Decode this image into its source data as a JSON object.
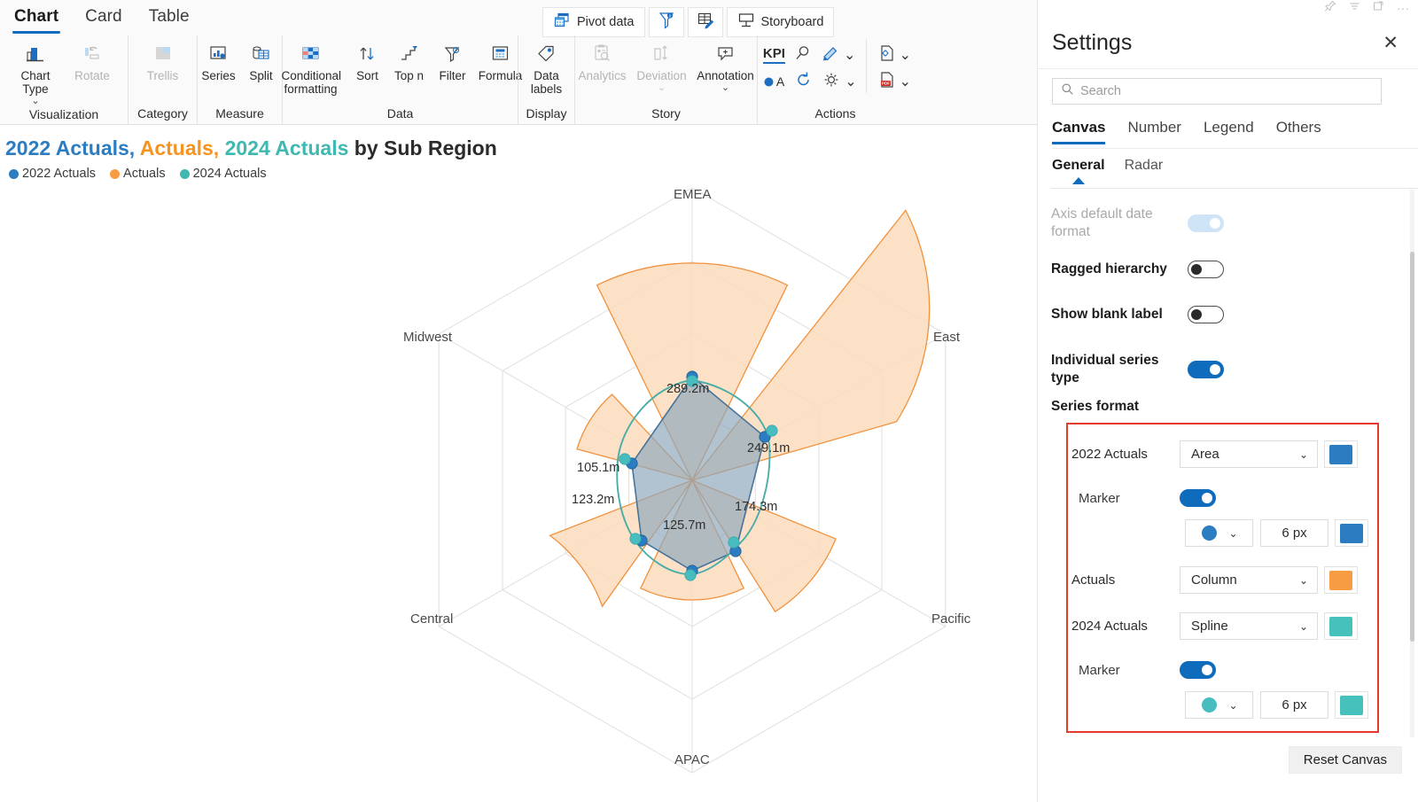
{
  "ribbon": {
    "tabs": [
      {
        "label": "Chart",
        "active": true
      },
      {
        "label": "Card",
        "active": false
      },
      {
        "label": "Table",
        "active": false
      }
    ],
    "groups": [
      {
        "title": "Visualization",
        "items": [
          {
            "label": "Chart Type",
            "icon": "bar-chart-icon",
            "disabled": false,
            "caret": true
          },
          {
            "label": "Rotate",
            "icon": "rotate-icon",
            "disabled": true,
            "caret": false
          }
        ]
      },
      {
        "title": "Category",
        "items": [
          {
            "label": "Trellis",
            "icon": "trellis-grid-icon",
            "disabled": true,
            "caret": false
          }
        ]
      },
      {
        "title": "Measure",
        "items": [
          {
            "label": "Series",
            "icon": "series-icon",
            "disabled": false,
            "caret": false
          },
          {
            "label": "Split",
            "icon": "split-icon",
            "disabled": false,
            "caret": false
          }
        ]
      },
      {
        "title": "Data",
        "items": [
          {
            "label": "Conditional formatting",
            "icon": "conditional-formatting-icon",
            "disabled": false,
            "caret": true
          },
          {
            "label": "Sort",
            "icon": "sort-icon",
            "disabled": false,
            "caret": false
          },
          {
            "label": "Top n",
            "icon": "top-n-icon",
            "disabled": false,
            "caret": false
          },
          {
            "label": "Filter",
            "icon": "filter-icon",
            "disabled": false,
            "caret": false
          },
          {
            "label": "Formula",
            "icon": "formula-icon",
            "disabled": false,
            "caret": false
          }
        ]
      },
      {
        "title": "Display",
        "items": [
          {
            "label": "Data labels",
            "icon": "tag-icon",
            "disabled": false,
            "caret": false
          }
        ]
      },
      {
        "title": "Story",
        "items": [
          {
            "label": "Analytics",
            "icon": "analytics-icon",
            "disabled": true,
            "caret": false
          },
          {
            "label": "Deviation",
            "icon": "deviation-icon",
            "disabled": true,
            "caret": true
          },
          {
            "label": "Annotation",
            "icon": "annotation-icon",
            "disabled": false,
            "caret": true
          }
        ]
      },
      {
        "title": "Actions",
        "items": []
      }
    ],
    "commands": [
      {
        "label": "Pivot data",
        "icon": "pivot-data-icon"
      },
      {
        "label": "",
        "icon": "filter-settings-icon"
      },
      {
        "label": "",
        "icon": "edit-table-icon"
      },
      {
        "label": "Storyboard",
        "icon": "storyboard-icon"
      }
    ],
    "action_icons": [
      {
        "name": "kpi-icon",
        "label": "KPI"
      },
      {
        "name": "search-icon",
        "label": ""
      },
      {
        "name": "brush-icon",
        "label": ""
      },
      {
        "name": "text-color-icon",
        "label": "A"
      },
      {
        "name": "refresh-icon",
        "label": ""
      },
      {
        "name": "gear-icon",
        "label": ""
      },
      {
        "name": "document-settings-icon",
        "label": ""
      },
      {
        "name": "export-pdf-icon",
        "label": "PDF"
      }
    ]
  },
  "chart_header": {
    "title_parts": [
      {
        "text": "2022 Actuals, ",
        "color": "#2b7cc0"
      },
      {
        "text": "Actuals, ",
        "color": "#f7931e"
      },
      {
        "text": "2024 Actuals ",
        "color": "#3fb8b0"
      },
      {
        "text": "by Sub Region",
        "color": "#2b2b2b"
      }
    ],
    "legend": [
      {
        "label": "2022 Actuals",
        "color": "#2b7cc0"
      },
      {
        "label": "Actuals",
        "color": "#f79c42"
      },
      {
        "label": "2024 Actuals",
        "color": "#3fb8b0"
      }
    ]
  },
  "chart_data": {
    "type": "radar",
    "title": "2022 Actuals, Actuals, 2024 Actuals by Sub Region",
    "xlabel": "Sub Region",
    "ylabel": "",
    "grid": true,
    "legend_position": "top-left",
    "categories": [
      "EMEA",
      "East",
      "Pacific",
      "APAC",
      "Central",
      "Midwest"
    ],
    "data_labels": [
      "289.2m",
      "249.1m",
      "174.3m",
      "125.7m",
      "123.2m",
      "105.1m"
    ],
    "series": [
      {
        "name": "2022 Actuals",
        "render_type": "Area",
        "color": "#2b7cc0",
        "marker": true,
        "marker_shape": "circle",
        "marker_size_px": 6,
        "values": [
          289.2,
          249.1,
          160.0,
          125.7,
          118.0,
          98.0
        ],
        "labels": [
          "289.2m",
          "249.1m",
          "",
          "125.7m",
          "",
          ""
        ]
      },
      {
        "name": "Actuals",
        "render_type": "Column",
        "color": "#f79c42",
        "marker": false,
        "values": [
          980.0,
          760.0,
          540.0,
          300.0,
          420.0,
          300.0
        ],
        "labels": [
          "",
          "",
          "",
          "",
          "",
          ""
        ]
      },
      {
        "name": "2024 Actuals",
        "render_type": "Spline",
        "color": "#3fb8b0",
        "marker": true,
        "marker_shape": "circle",
        "marker_size_px": 6,
        "values": [
          280.0,
          255.0,
          174.3,
          130.0,
          123.2,
          105.1
        ],
        "labels": [
          "",
          "",
          "174.3m",
          "",
          "123.2m",
          "105.1m"
        ]
      }
    ],
    "rings": 4,
    "axis_tick_labels": []
  },
  "panel": {
    "title": "Settings",
    "close_label": "✕",
    "window_icons": [
      "pin-icon",
      "list-icon",
      "popout-icon",
      "more-icon"
    ],
    "search": {
      "placeholder": "Search",
      "value": "",
      "icon": "search-icon"
    },
    "tabs": [
      {
        "label": "Canvas",
        "active": true
      },
      {
        "label": "Number",
        "active": false
      },
      {
        "label": "Legend",
        "active": false
      },
      {
        "label": "Others",
        "active": false
      }
    ],
    "subtabs": [
      {
        "label": "General",
        "active": true
      },
      {
        "label": "Radar",
        "active": false
      }
    ],
    "settings": [
      {
        "label": "Axis default date format",
        "state": "on",
        "disabled": true
      },
      {
        "label": "Ragged hierarchy",
        "state": "off",
        "disabled": false
      },
      {
        "label": "Show blank label",
        "state": "off",
        "disabled": false
      },
      {
        "label": "Individual series type",
        "state": "on",
        "disabled": false
      }
    ],
    "series_format": {
      "title": "Series format",
      "rows": [
        {
          "kind": "series",
          "name": "2022 Actuals",
          "type_value": "Area",
          "color": "#2b7cc0"
        },
        {
          "kind": "marker",
          "name": "Marker",
          "enabled": true,
          "shape_color": "#2b7cc0",
          "size_value": "6 px",
          "color": "#2b7cc0"
        },
        {
          "kind": "series",
          "name": "Actuals",
          "type_value": "Column",
          "color": "#f79c42"
        },
        {
          "kind": "series",
          "name": "2024 Actuals",
          "type_value": "Spline",
          "color": "#45c0bb"
        },
        {
          "kind": "marker",
          "name": "Marker",
          "enabled": true,
          "shape_color": "#45c0bb",
          "size_value": "6 px",
          "color": "#45c0bb"
        }
      ]
    },
    "reset_label": "Reset Canvas"
  }
}
